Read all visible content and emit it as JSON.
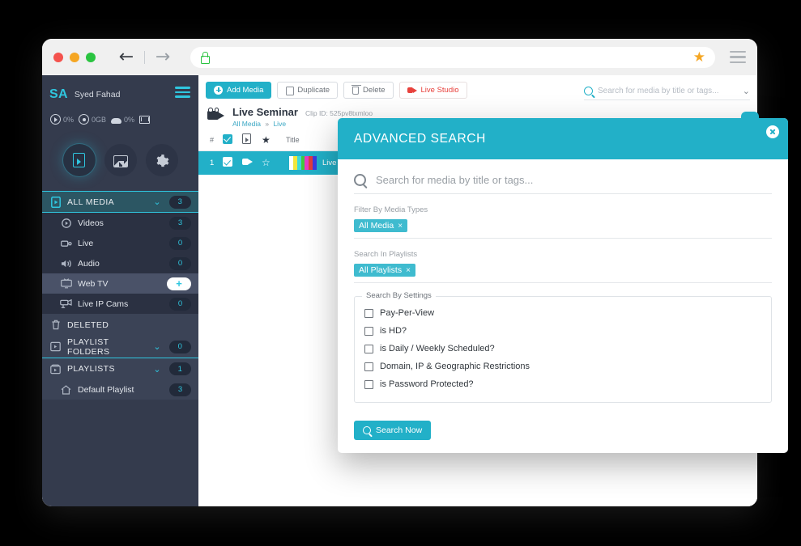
{
  "browser": {
    "traffic_lights": [
      "close",
      "minimize",
      "maximize"
    ],
    "back_arrow": "←",
    "forward_arrow": "→",
    "url_value": "",
    "url_placeholder": "",
    "lock_icon": "lock-icon",
    "bookmark_icon": "★",
    "menu_icon": "hamburger-icon"
  },
  "sidebar": {
    "avatar_initials": "SA",
    "user_name": "Syed Fahad",
    "stats": [
      {
        "icon": "play-circle-icon",
        "value": "0%"
      },
      {
        "icon": "disk-usage-icon",
        "value": "0GB"
      },
      {
        "icon": "cloud-icon",
        "value": "0%"
      },
      {
        "icon": "mail-icon",
        "value": ""
      }
    ],
    "circle_buttons": [
      {
        "name": "media-library-button",
        "icon": "media-file-icon",
        "active": true
      },
      {
        "name": "analytics-button",
        "icon": "chart-icon",
        "active": false
      },
      {
        "name": "settings-button",
        "icon": "gear-icon",
        "active": false
      }
    ],
    "nav": {
      "all_media": {
        "label": "ALL MEDIA",
        "count": "3",
        "chevron": "⌄",
        "icon": "media-file-icon"
      },
      "items": [
        {
          "label": "Videos",
          "count": "3",
          "icon": "play-circle-icon",
          "highlight": false
        },
        {
          "label": "Live",
          "count": "0",
          "icon": "video-camera-icon",
          "highlight": false
        },
        {
          "label": "Audio",
          "count": "0",
          "icon": "speaker-icon",
          "highlight": false
        },
        {
          "label": "Web TV",
          "count": "+",
          "icon": "tv-icon",
          "highlight": true
        },
        {
          "label": "Live IP Cams",
          "count": "0",
          "icon": "ip-camera-icon",
          "highlight": false
        }
      ],
      "deleted": {
        "label": "DELETED",
        "icon": "trash-icon"
      },
      "folders": {
        "label": "PLAYLIST FOLDERS",
        "count": "0",
        "chevron": "⌄",
        "icon": "folder-icon"
      },
      "playlists": {
        "label": "PLAYLISTS",
        "count": "1",
        "chevron": "⌄",
        "icon": "playlist-icon"
      },
      "playlist_items": [
        {
          "label": "Default Playlist",
          "count": "3",
          "icon": "home-icon"
        }
      ]
    }
  },
  "toolbar": {
    "buttons": [
      {
        "label": "Add Media",
        "icon": "plus-circle-icon",
        "style": "primary"
      },
      {
        "label": "Duplicate",
        "icon": "copy-icon",
        "style": "default"
      },
      {
        "label": "Delete",
        "icon": "trash-icon",
        "style": "default"
      },
      {
        "label": "Live Studio",
        "icon": "live-studio-icon",
        "style": "live"
      }
    ]
  },
  "top_search": {
    "placeholder": "Search for media by title or tags...",
    "value": "",
    "icon": "search-icon",
    "chevron": "⌄"
  },
  "content": {
    "media_icon": "film-camera-icon",
    "title": "Live Seminar",
    "clip_id": "Clip ID: 525pv8txmloo",
    "breadcrumb": {
      "root": "All Media",
      "separator": "»",
      "current": "Live"
    },
    "table": {
      "headers": {
        "num": "#",
        "select_icon": "checkbox-checked-icon",
        "type_icon": "media-file-icon",
        "star_icon": "star-icon",
        "title": "Title"
      },
      "rows": [
        {
          "num": "1",
          "checked": true,
          "type_icon": "live-studio-icon",
          "starred": false,
          "thumbnail": "color-bars-thumbnail",
          "title": "Live "
        }
      ]
    }
  },
  "dialog": {
    "title": "ADVANCED SEARCH",
    "close_icon": "close-icon",
    "search": {
      "placeholder": "Search for media by title or tags...",
      "value": "",
      "icon": "search-icon"
    },
    "media_types": {
      "label": "Filter By Media Types",
      "tags": [
        {
          "label": "All Media",
          "remove": "×"
        }
      ]
    },
    "playlists": {
      "label": "Search In Playlists",
      "tags": [
        {
          "label": "All Playlists",
          "remove": "×"
        }
      ]
    },
    "settings": {
      "legend": "Search By Settings",
      "checkboxes": [
        {
          "label": "Pay-Per-View",
          "checked": false
        },
        {
          "label": "is HD?",
          "checked": false
        },
        {
          "label": "is Daily / Weekly Scheduled?",
          "checked": false
        },
        {
          "label": "Domain, IP & Geographic Restrictions",
          "checked": false
        },
        {
          "label": "is Password Protected?",
          "checked": false
        }
      ]
    },
    "submit": {
      "label": "Search Now",
      "icon": "search-icon"
    }
  },
  "colors": {
    "accent_teal": "#22b0c8",
    "sidebar_dark": "#343b4d",
    "sidebar_item": "#2b3142",
    "highlight_row": "#4a5268",
    "live_red": "#e8413c",
    "cyan_text": "#2fc6df"
  }
}
